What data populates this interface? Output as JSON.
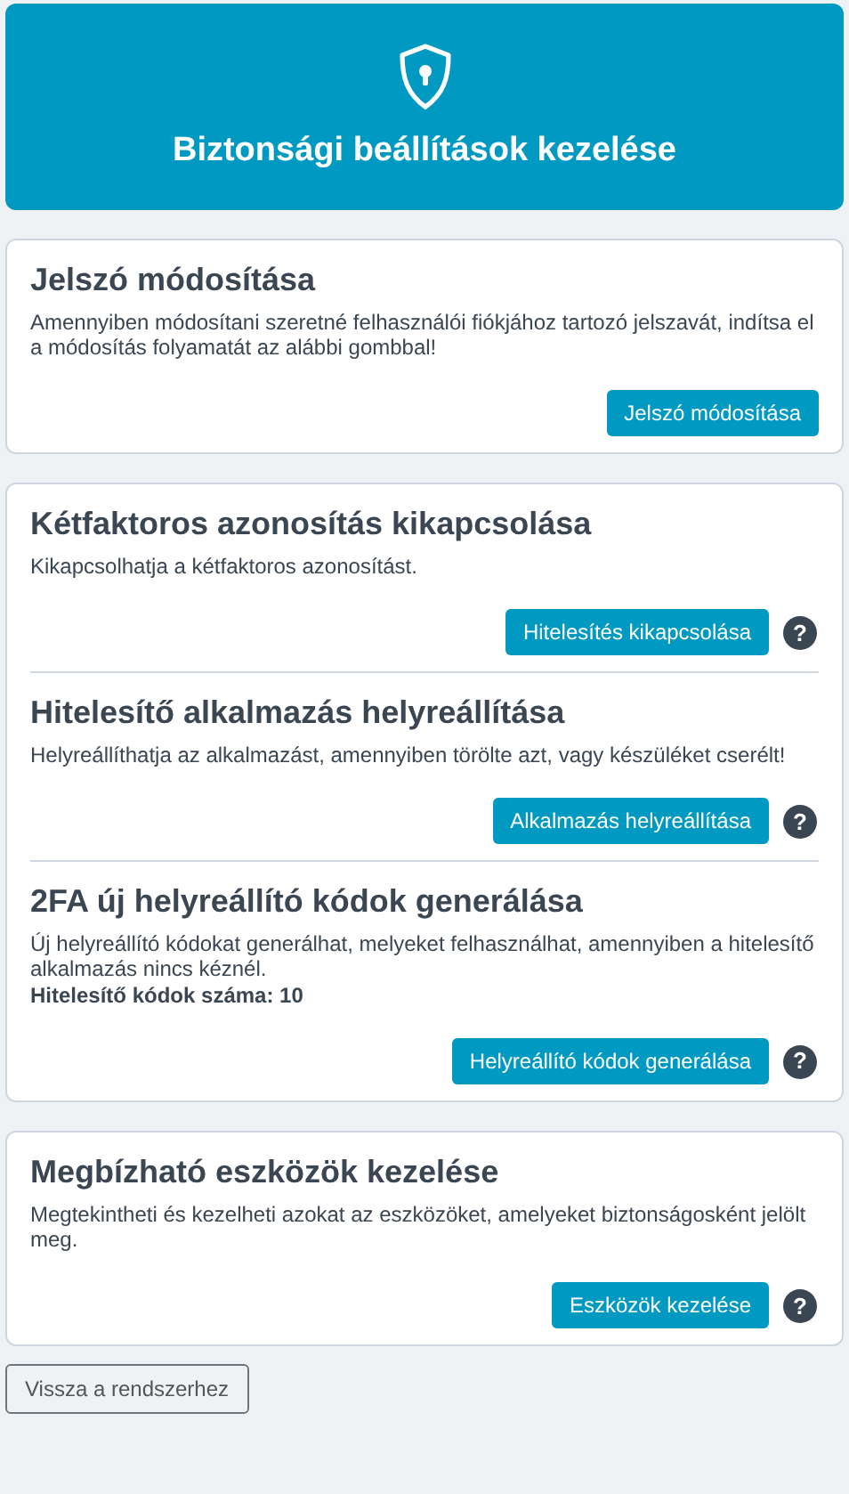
{
  "header": {
    "title": "Biztonsági beállítások kezelése"
  },
  "cards": [
    {
      "sections": [
        {
          "title": "Jelszó módosítása",
          "lines": [
            {
              "text": "Amennyiben módosítani szeretné felhasználói fiókjához tartozó jelszavát, indítsa el a módosítás folyamatát az alábbi gombbal!",
              "bold": false
            }
          ],
          "button": "Jelszó módosítása"
        }
      ]
    },
    {
      "sections": [
        {
          "title": "Kétfaktoros azonosítás kikapcsolása",
          "lines": [
            {
              "text": "Kikapcsolhatja a kétfaktoros azonosítást.",
              "bold": false
            }
          ],
          "button": "Hitelesítés kikapcsolása",
          "help": "?"
        },
        {
          "title": "Hitelesítő alkalmazás helyreállítása",
          "lines": [
            {
              "text": "Helyreállíthatja az alkalmazást, amennyiben törölte azt, vagy készüléket cserélt!",
              "bold": false
            }
          ],
          "button": "Alkalmazás helyreállítása",
          "help": "?"
        },
        {
          "title": "2FA új helyreállító kódok generálása",
          "lines": [
            {
              "text": "Új helyreállító kódokat generálhat, melyeket felhasználhat, amennyiben a hitelesítő alkalmazás nincs kéznél.",
              "bold": false
            },
            {
              "text": "Hitelesítő kódok száma: 10",
              "bold": true
            }
          ],
          "button": "Helyreállító kódok generálása",
          "help": "?"
        }
      ]
    },
    {
      "sections": [
        {
          "title": "Megbízható eszközök kezelése",
          "lines": [
            {
              "text": "Megtekintheti és kezelheti azokat az eszközöket, amelyeket biztonságosként jelölt meg.",
              "bold": false
            }
          ],
          "button": "Eszközök kezelése",
          "help": "?"
        }
      ]
    }
  ],
  "back_button": "Vissza a rendszerhez"
}
